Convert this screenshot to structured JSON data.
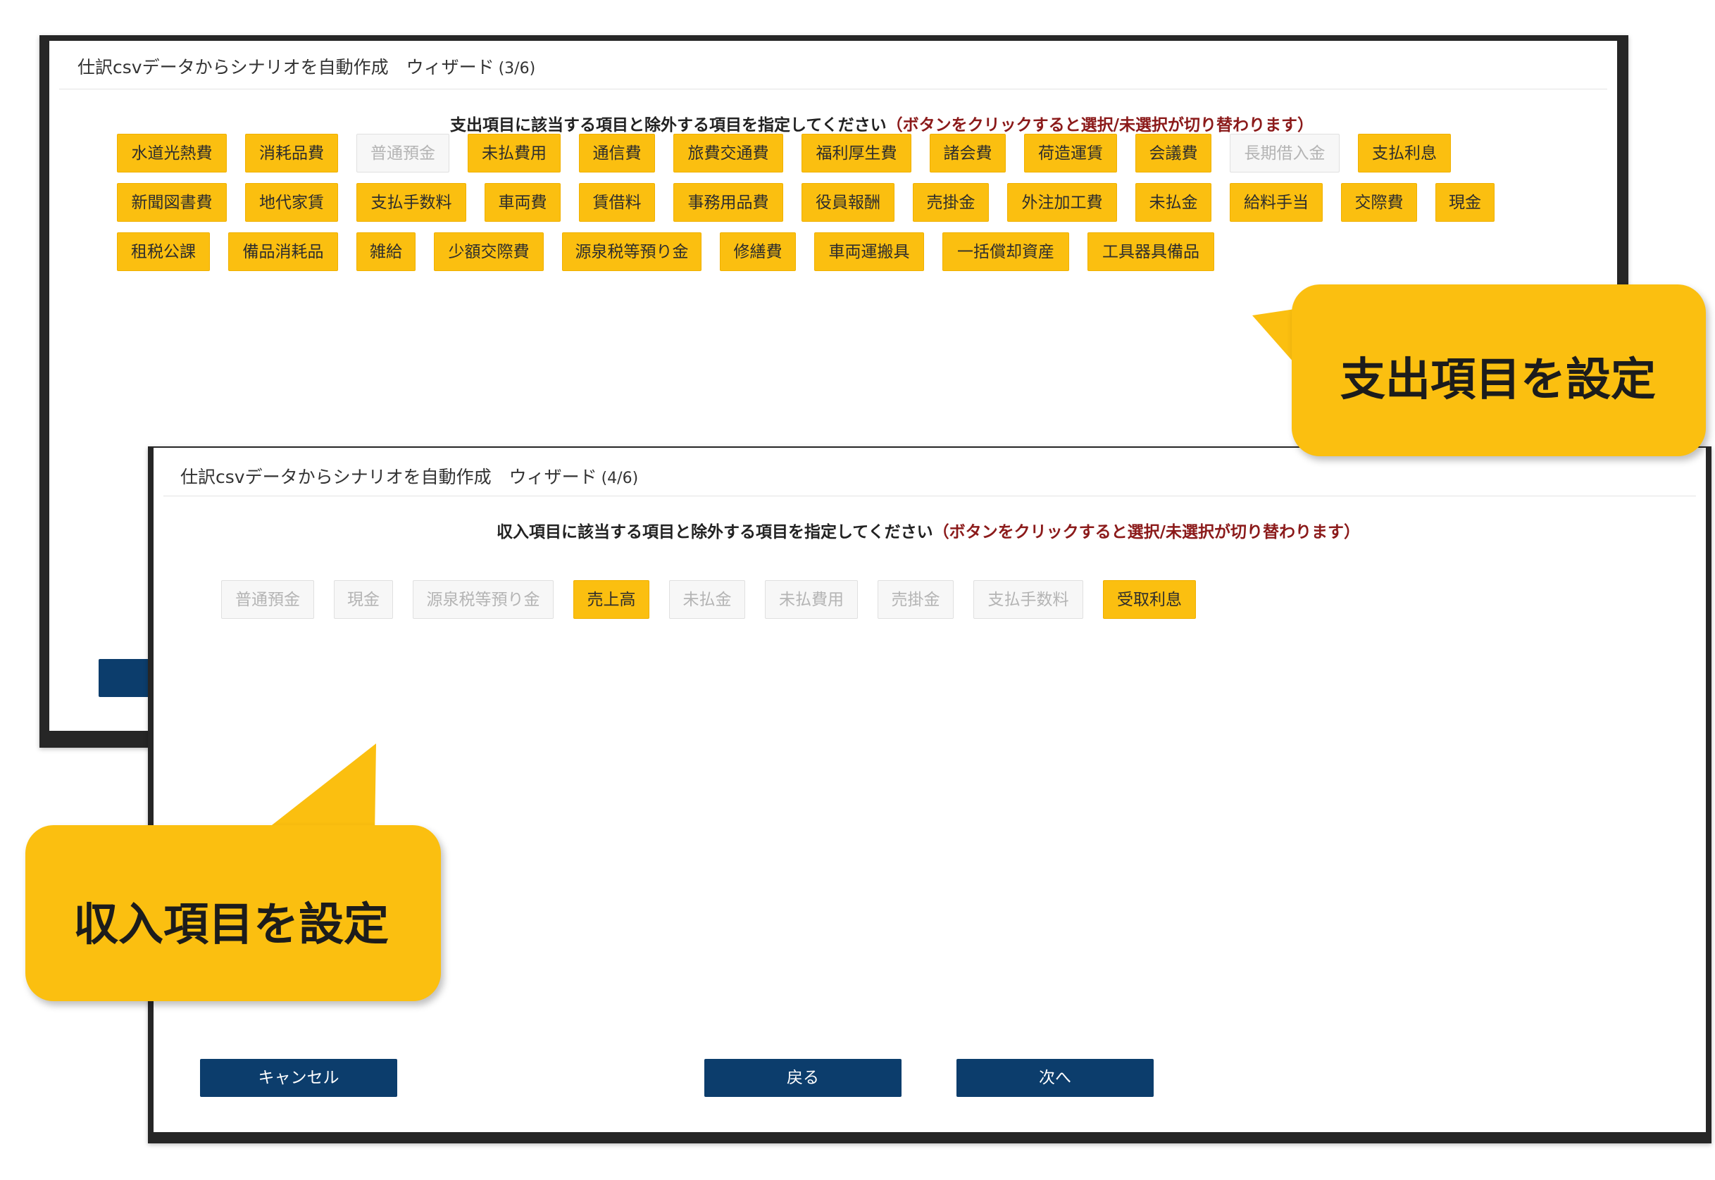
{
  "wizard_back": {
    "title": "仕訳csvデータからシナリオを自動作成　ウィザード",
    "step": "(3/6)",
    "instruction": "支出項目に該当する項目と除外する項目を指定してください",
    "instruction_note": "（ボタンをクリックすると選択/未選択が切り替わります）",
    "tags": [
      {
        "label": "水道光熱費",
        "selected": true
      },
      {
        "label": "消耗品費",
        "selected": true
      },
      {
        "label": "普通預金",
        "selected": false
      },
      {
        "label": "未払費用",
        "selected": true
      },
      {
        "label": "通信費",
        "selected": true
      },
      {
        "label": "旅費交通費",
        "selected": true
      },
      {
        "label": "福利厚生費",
        "selected": true
      },
      {
        "label": "諸会費",
        "selected": true
      },
      {
        "label": "荷造運賃",
        "selected": true
      },
      {
        "label": "会議費",
        "selected": true
      },
      {
        "label": "長期借入金",
        "selected": false
      },
      {
        "label": "支払利息",
        "selected": true
      },
      {
        "label": "新聞図書費",
        "selected": true
      },
      {
        "label": "地代家賃",
        "selected": true
      },
      {
        "label": "支払手数料",
        "selected": true
      },
      {
        "label": "車両費",
        "selected": true
      },
      {
        "label": "賃借料",
        "selected": true
      },
      {
        "label": "事務用品費",
        "selected": true
      },
      {
        "label": "役員報酬",
        "selected": true
      },
      {
        "label": "売掛金",
        "selected": true
      },
      {
        "label": "外注加工費",
        "selected": true
      },
      {
        "label": "未払金",
        "selected": true
      },
      {
        "label": "給料手当",
        "selected": true
      },
      {
        "label": "交際費",
        "selected": true
      },
      {
        "label": "現金",
        "selected": true
      },
      {
        "label": "租税公課",
        "selected": true
      },
      {
        "label": "備品消耗品",
        "selected": true
      },
      {
        "label": "雑給",
        "selected": true
      },
      {
        "label": "少額交際費",
        "selected": true
      },
      {
        "label": "源泉税等預り金",
        "selected": true
      },
      {
        "label": "修繕費",
        "selected": true
      },
      {
        "label": "車両運搬具",
        "selected": true
      },
      {
        "label": "一括償却資産",
        "selected": true
      },
      {
        "label": "工具器具備品",
        "selected": true
      }
    ]
  },
  "wizard_front": {
    "title": "仕訳csvデータからシナリオを自動作成　ウィザード",
    "step": "(4/6)",
    "instruction": "収入項目に該当する項目と除外する項目を指定してください",
    "instruction_note": "（ボタンをクリックすると選択/未選択が切り替わります）",
    "tags": [
      {
        "label": "普通預金",
        "selected": false
      },
      {
        "label": "現金",
        "selected": false
      },
      {
        "label": "源泉税等預り金",
        "selected": false
      },
      {
        "label": "売上高",
        "selected": true
      },
      {
        "label": "未払金",
        "selected": false
      },
      {
        "label": "未払費用",
        "selected": false
      },
      {
        "label": "売掛金",
        "selected": false
      },
      {
        "label": "支払手数料",
        "selected": false
      },
      {
        "label": "受取利息",
        "selected": true
      }
    ],
    "buttons": {
      "cancel": "キャンセル",
      "back": "戻る",
      "next": "次へ"
    }
  },
  "callouts": {
    "expense": "支出項目を設定",
    "income": "収入項目を設定"
  },
  "colors": {
    "selected": "#fbbf10",
    "unselected": "#f7f7f7",
    "button": "#0c3d6c",
    "note": "#8b1a1a"
  }
}
